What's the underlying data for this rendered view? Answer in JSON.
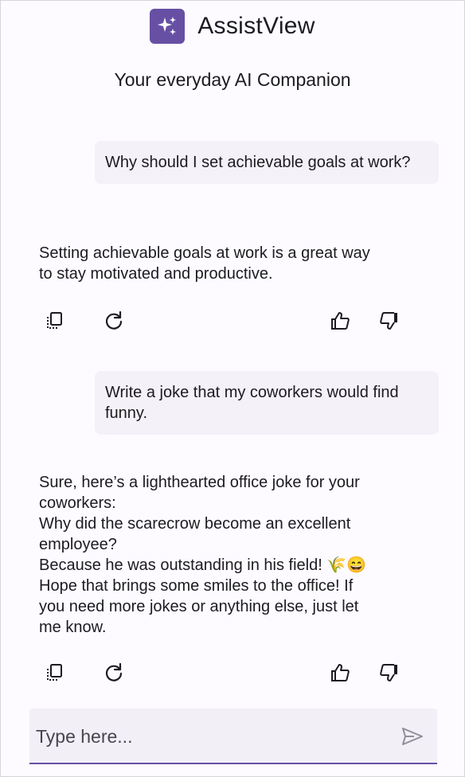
{
  "app": {
    "title": "AssistView",
    "subtitle": "Your everyday AI Companion"
  },
  "messages": [
    {
      "role": "user",
      "text": "Why should I set achievable goals at work?"
    },
    {
      "role": "assistant",
      "lines": [
        "Setting achievable goals at work is a great way",
        "to stay motivated and productive."
      ]
    },
    {
      "role": "user",
      "text": "Write a joke that my coworkers would find funny."
    },
    {
      "role": "assistant",
      "lines": [
        "Sure, here’s a lighthearted office joke for your",
        "coworkers:",
        "Why did the scarecrow become an excellent",
        "employee?",
        "Because he was outstanding in his field! 🌾😄",
        "Hope that brings some smiles to the office! If",
        "you need more jokes or anything else, just let",
        "me know."
      ]
    }
  ],
  "actions": [
    "copy-icon",
    "refresh-icon",
    "thumbs-up-icon",
    "thumbs-down-icon"
  ],
  "input": {
    "placeholder": "Type here...",
    "value": ""
  },
  "colors": {
    "accent": "#6750a4",
    "bubble": "#f4f1f9",
    "input_bg": "#f3eff7"
  }
}
